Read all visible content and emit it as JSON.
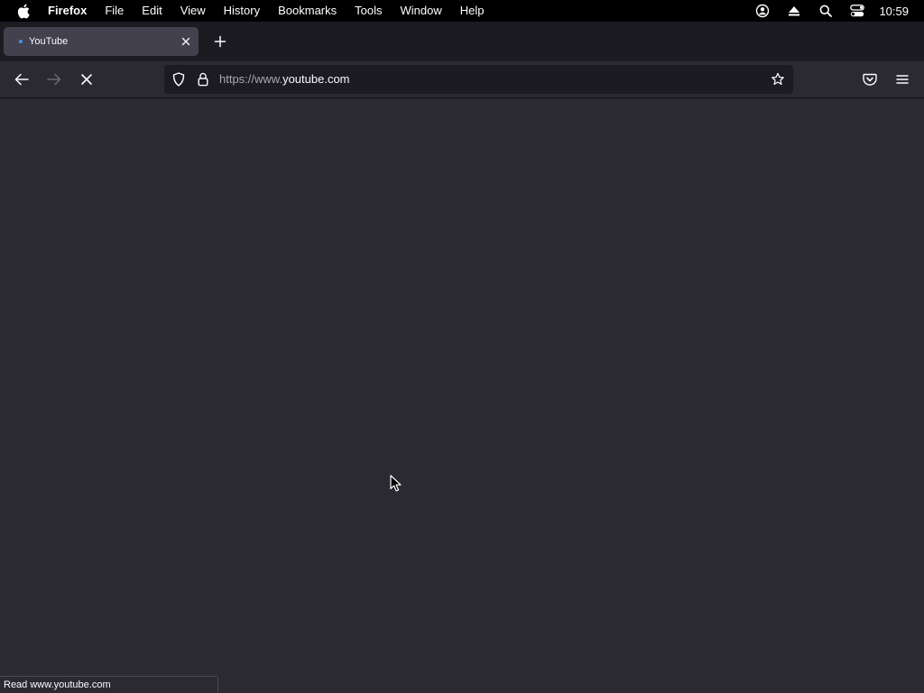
{
  "menubar": {
    "apple_icon": "apple-logo",
    "app_name": "Firefox",
    "items": [
      "File",
      "Edit",
      "View",
      "History",
      "Bookmarks",
      "Tools",
      "Window",
      "Help"
    ],
    "status_icons": [
      "user-account-icon",
      "eject-icon",
      "spotlight-search-icon",
      "control-center-icon"
    ],
    "clock": "10:59"
  },
  "tabs": [
    {
      "title": "YouTube",
      "loading": true
    }
  ],
  "navbar": {
    "url_prefix": "https://www.",
    "url_domain": "youtube.com"
  },
  "statusbar": {
    "text": "Read www.youtube.com"
  },
  "colors": {
    "menubar_bg": "#000000",
    "tabstrip_bg": "#1c1b22",
    "active_tab_bg": "#42414d",
    "toolbar_bg": "#2b2a33",
    "urlbar_bg": "#1c1b22",
    "content_bg": "#2b2a33",
    "loading_accent": "#4a8fe8"
  }
}
